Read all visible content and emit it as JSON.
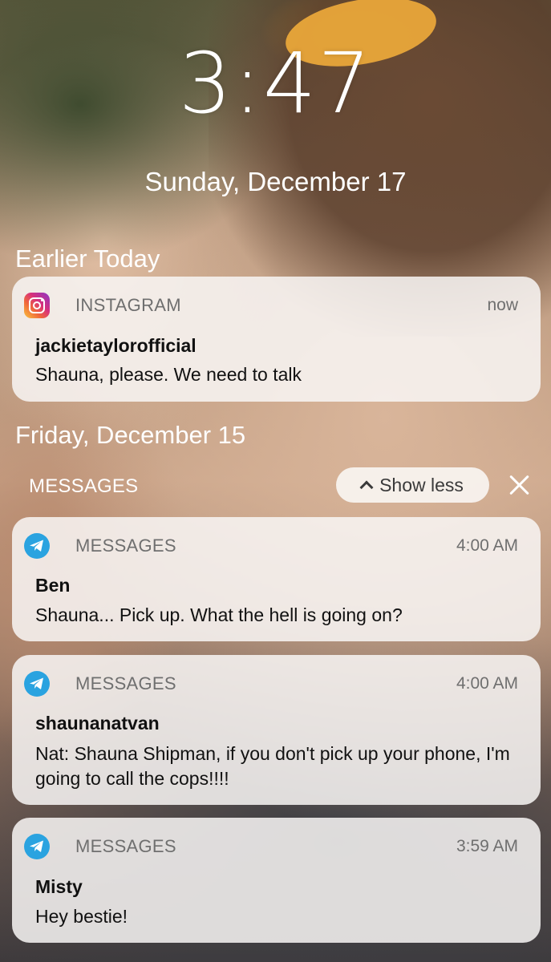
{
  "lockscreen": {
    "time": "3:47",
    "date": "Sunday, December 17"
  },
  "sections": {
    "earlier_today": "Earlier Today",
    "friday": "Friday, December 15"
  },
  "group": {
    "label": "MESSAGES",
    "show_less_label": "Show less"
  },
  "notifications": [
    {
      "app": "INSTAGRAM",
      "app_icon": "instagram-icon",
      "time": "now",
      "title": "jackietaylorofficial",
      "body": "Shauna, please. We need to talk"
    },
    {
      "app": "MESSAGES",
      "app_icon": "telegram-icon",
      "time": "4:00 AM",
      "title": "Ben",
      "body": "Shauna... Pick up. What the hell is going on?"
    },
    {
      "app": "MESSAGES",
      "app_icon": "telegram-icon",
      "time": "4:00 AM",
      "title": "shaunanatvan",
      "body": "Nat: Shauna Shipman, if you don't pick up your phone, I'm going to call the cops!!!!"
    },
    {
      "app": "MESSAGES",
      "app_icon": "telegram-icon",
      "time": "3:59 AM",
      "title": "Misty",
      "body": "Hey bestie!"
    }
  ],
  "colors": {
    "telegram_blue": "#2aa3e0",
    "card_background": "#f8f6f4"
  }
}
